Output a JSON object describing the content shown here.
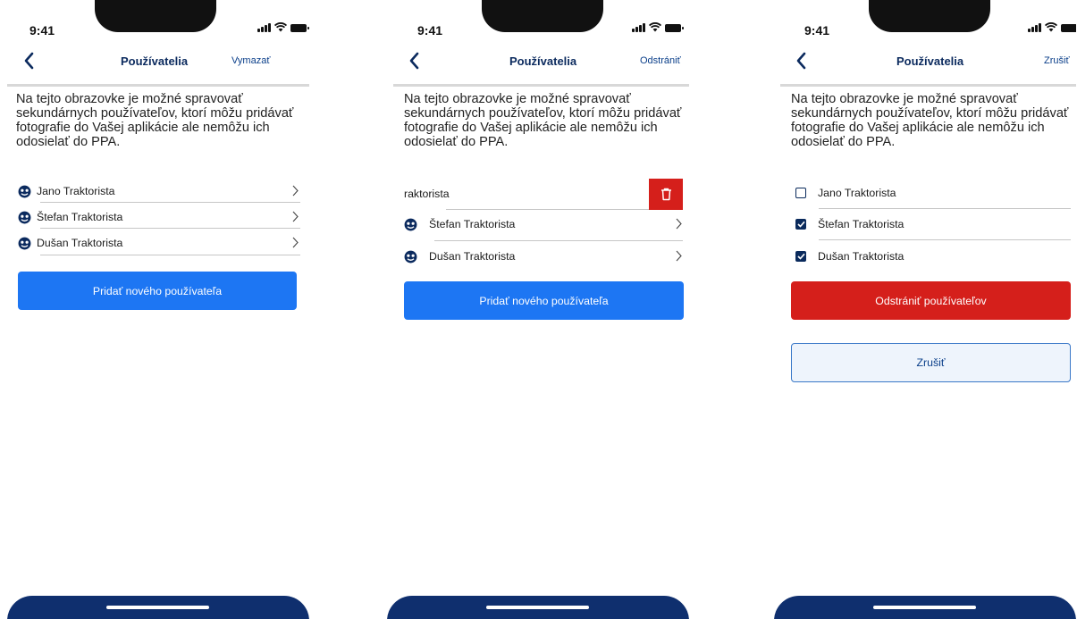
{
  "status": {
    "time": "9:41"
  },
  "nav": {
    "title": "Používatelia",
    "action_1": "Vymazať",
    "action_2": "Odstrániť",
    "action_3": "Zrušiť"
  },
  "description": "Na tejto obrazovke je možné spravovať sekundárnych používateľov, ktorí môžu pridávať fotografie do Vašej aplikácie ale nemôžu ich odosielať do PPA.",
  "users": [
    "Jano Traktorista",
    "Štefan Traktorista",
    "Dušan Traktorista"
  ],
  "swiped_row_label": "raktorista",
  "selected": [
    false,
    true,
    true
  ],
  "buttons": {
    "add_user": "Pridať nového používateľa",
    "remove_users": "Odstrániť používateľov",
    "cancel": "Zrušiť"
  },
  "icons": {
    "back": "chevron-left-icon",
    "row": "chevron-right-icon",
    "avatar": "user-avatar-icon",
    "delete": "trash-icon",
    "check": "check-icon"
  },
  "colors": {
    "primary": "#1d76f3",
    "danger": "#d51f1b",
    "navy": "#0f2f6e",
    "title": "#0b2a5e"
  }
}
